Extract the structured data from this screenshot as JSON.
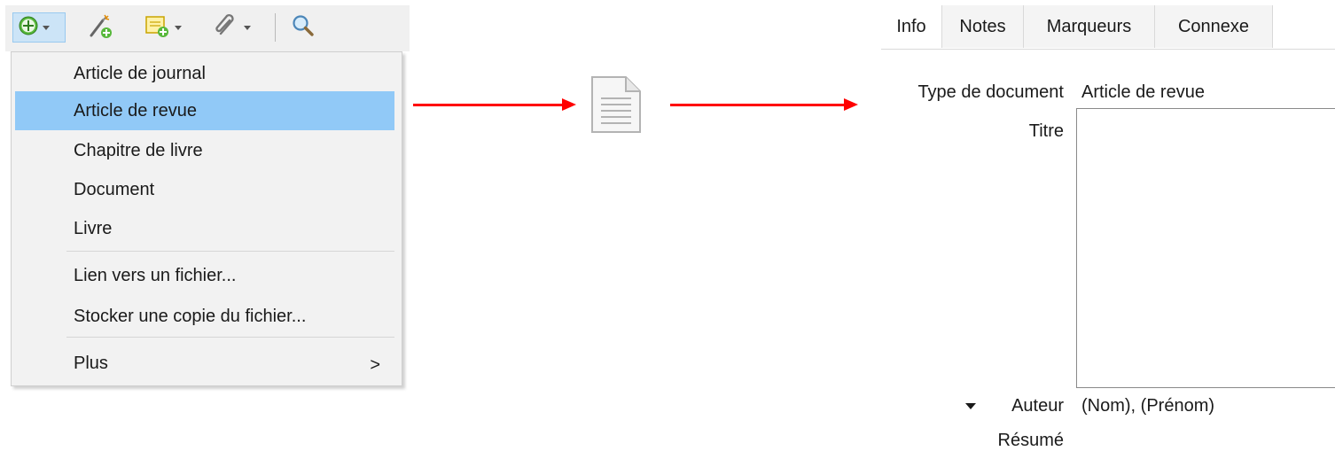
{
  "toolbar": {
    "icons": [
      "new-item-icon",
      "add-by-identifier-icon",
      "new-note-icon",
      "attachment-icon",
      "search-icon"
    ]
  },
  "new_item_menu": {
    "items": [
      {
        "label": "Article de journal"
      },
      {
        "label": "Article de revue",
        "selected": true
      },
      {
        "label": "Chapitre de livre"
      },
      {
        "label": "Document"
      },
      {
        "label": "Livre"
      }
    ],
    "file_items": [
      {
        "label": "Lien vers un fichier..."
      },
      {
        "label": "Stocker une copie du fichier..."
      }
    ],
    "more_label": "Plus",
    "more_arrow": ">"
  },
  "flow": {
    "arrow_color": "#ff0000",
    "icon": "document-icon"
  },
  "item_pane": {
    "tabs": [
      "Info",
      "Notes",
      "Marqueurs",
      "Connexe"
    ],
    "active_tab": "Info",
    "fields": {
      "type_label": "Type de document",
      "type_value": "Article de revue",
      "title_label": "Titre",
      "title_value": "",
      "author_label": "Auteur",
      "author_value": "(Nom), (Prénom)",
      "abstract_label": "Résumé"
    }
  },
  "colors": {
    "menu_selection": "#91c9f7",
    "toolbar_bg": "#f0f0f0",
    "active_button": "#cce4f7"
  }
}
